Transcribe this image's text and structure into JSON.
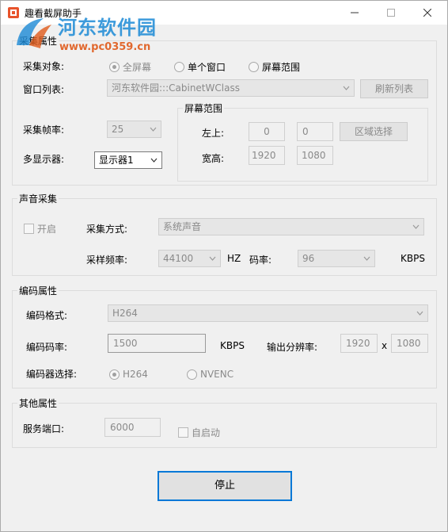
{
  "window": {
    "title": "趣看截屏助手",
    "watermark_site": "河东软件园",
    "watermark_url": "www.pc0359.cn"
  },
  "capture": {
    "group_title": "采集属性",
    "target_label": "采集对象:",
    "target_options": [
      "全屏幕",
      "单个窗口",
      "屏幕范围"
    ],
    "selected_target": "全屏幕",
    "window_list_label": "窗口列表:",
    "window_list_value": "河东软件园:::CabinetWClass",
    "refresh_label": "刷新列表",
    "fps_label": "采集帧率:",
    "fps_value": "25",
    "display_label": "多显示器:",
    "display_value": "显示器1",
    "region": {
      "title": "屏幕范围",
      "topleft_label": "左上:",
      "x": "0",
      "y": "0",
      "select_label": "区域选择",
      "size_label": "宽高:",
      "w": "1920",
      "h": "1080"
    }
  },
  "audio": {
    "group_title": "声音采集",
    "enable_label": "开启",
    "method_label": "采集方式:",
    "method_value": "系统声音",
    "rate_label": "采样频率:",
    "rate_value": "44100",
    "rate_unit": "HZ",
    "bitrate_label": "码率:",
    "bitrate_value": "96",
    "bitrate_unit": "KBPS"
  },
  "encode": {
    "group_title": "编码属性",
    "format_label": "编码格式:",
    "format_value": "H264",
    "bitrate_label": "编码码率:",
    "bitrate_value": "1500",
    "bitrate_unit": "KBPS",
    "resolution_label": "输出分辨率:",
    "res_w": "1920",
    "res_x": "x",
    "res_h": "1080",
    "encoder_label": "编码器选择:",
    "encoder_options": [
      "H264",
      "NVENC"
    ],
    "selected_encoder": "H264"
  },
  "other": {
    "group_title": "其他属性",
    "port_label": "服务端口:",
    "port_value": "6000",
    "autostart_label": "自启动"
  },
  "stop_label": "停止",
  "colors": {
    "accent": "#0078d7",
    "watermark_blue": "#1c8ad6",
    "watermark_orange": "#e05a1a"
  }
}
